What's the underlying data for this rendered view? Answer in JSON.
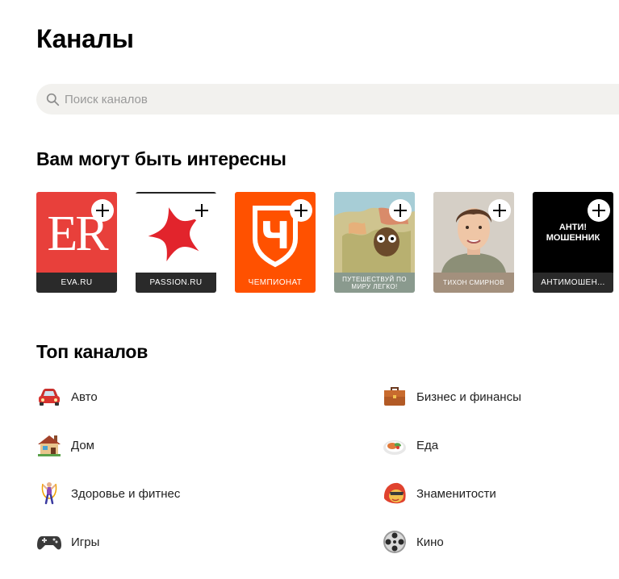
{
  "page": {
    "title": "Каналы"
  },
  "search": {
    "placeholder": "Поиск каналов"
  },
  "recommended": {
    "title": "Вам могут быть интересны",
    "channels": [
      {
        "label": "EVA.RU",
        "logo_text": "ER",
        "color": "#e8403b",
        "label_bg": "#2a2a2a"
      },
      {
        "label": "PASSION.RU",
        "color": "#ffffff",
        "label_bg": "#2a2a2a"
      },
      {
        "label": "ЧЕМПИОНАТ",
        "logo_text": "Ч",
        "color": "#ff5100",
        "label_bg": "#ff5100"
      },
      {
        "label": "ПУТЕШЕСТВУЙ ПО МИРУ ЛЕГКО!",
        "color": "#9fb6a8",
        "label_bg": "#8a9a8e"
      },
      {
        "label": "ТИХОН СМИРНОВ",
        "color": "#c7b8a5",
        "label_bg": "#a3907d"
      },
      {
        "label": "АНТИМОШЕН...",
        "logo_text": "АНТИ! МОШЕННИК",
        "color": "#000000",
        "label_bg": "#2a2a2a"
      }
    ]
  },
  "top": {
    "title": "Топ каналов",
    "categories": [
      {
        "label": "Авто",
        "icon": "car-icon"
      },
      {
        "label": "Бизнес и финансы",
        "icon": "briefcase-icon"
      },
      {
        "label": "Дом",
        "icon": "house-icon"
      },
      {
        "label": "Еда",
        "icon": "food-plate-icon"
      },
      {
        "label": "Здоровье и фитнес",
        "icon": "jump-rope-icon"
      },
      {
        "label": "Знаменитости",
        "icon": "celebrity-icon"
      },
      {
        "label": "Игры",
        "icon": "gamepad-icon"
      },
      {
        "label": "Кино",
        "icon": "film-reel-icon"
      }
    ]
  }
}
